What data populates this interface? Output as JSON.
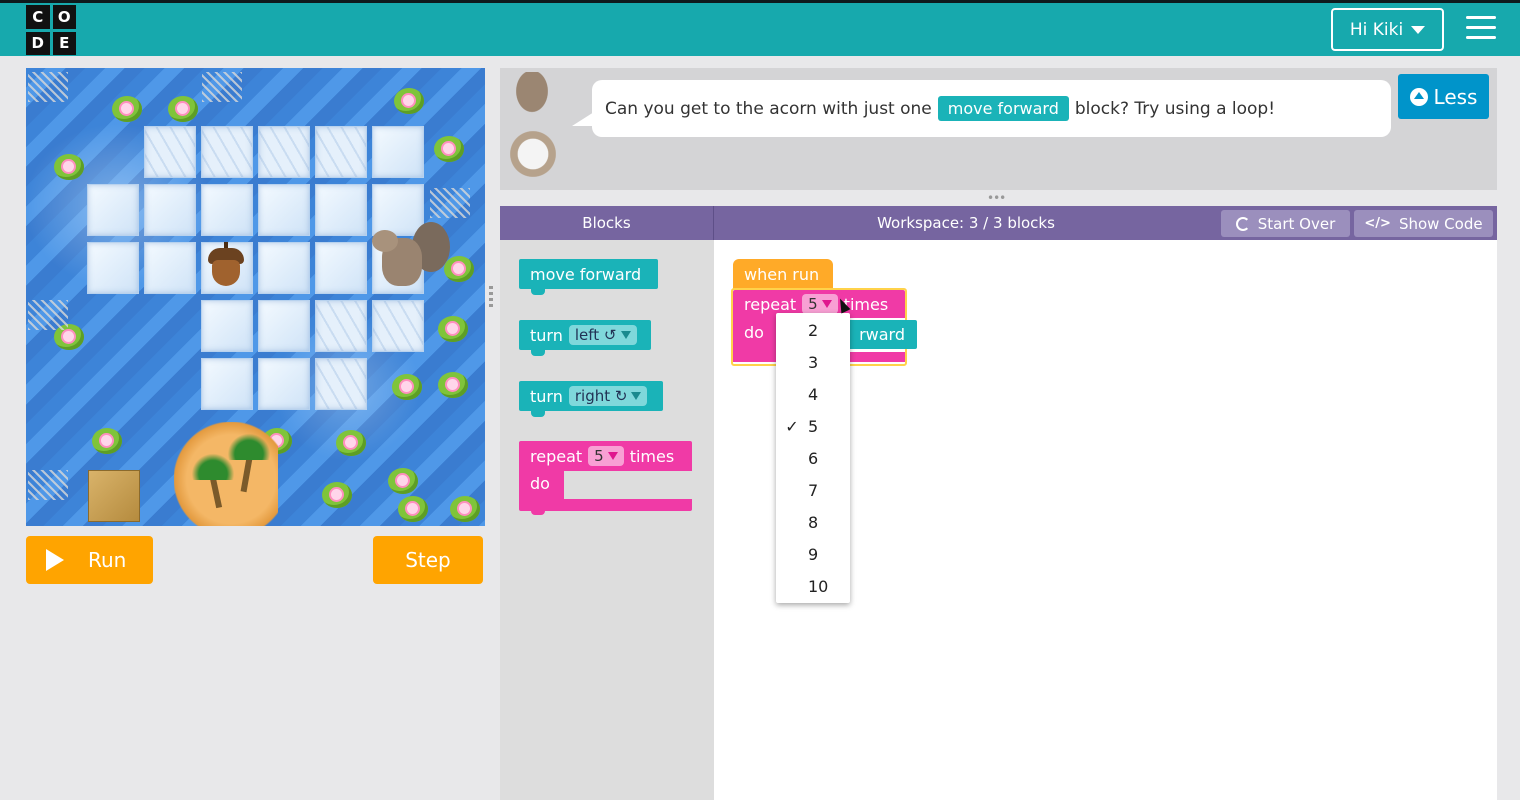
{
  "header": {
    "logo_letters": [
      "C",
      "O",
      "D",
      "E"
    ],
    "user_button_label": "Hi Kiki",
    "menu_icon": "hamburger-icon",
    "background_color": "#17a9ad"
  },
  "controls": {
    "run_label": "Run",
    "step_label": "Step",
    "accent_color": "#ffa400"
  },
  "instructions": {
    "text_before": "Can you get to the acorn with just one",
    "inline_block": "move forward",
    "text_after": "block? Try using a loop!",
    "less_label": "Less"
  },
  "workspace_header": {
    "blocks_label": "Blocks",
    "workspace_label": "Workspace: 3 / 3 blocks",
    "start_over_label": "Start Over",
    "show_code_label": "Show Code",
    "show_code_glyph": "</>"
  },
  "toolbox": {
    "move_forward": "move forward",
    "turn_left": {
      "label": "turn",
      "value": "left ↺"
    },
    "turn_right": {
      "label": "turn",
      "value": "right ↻"
    },
    "repeat": {
      "label": "repeat",
      "value": "5",
      "suffix": "times",
      "do": "do"
    }
  },
  "program": {
    "when_run": "when run",
    "repeat_label": "repeat",
    "repeat_value": "5",
    "repeat_suffix": "times",
    "do_label": "do",
    "inner_block_partial": "rward"
  },
  "dropdown": {
    "options": [
      "2",
      "3",
      "4",
      "5",
      "6",
      "7",
      "8",
      "9",
      "10"
    ],
    "selected": "5",
    "check_mark": "✓"
  }
}
